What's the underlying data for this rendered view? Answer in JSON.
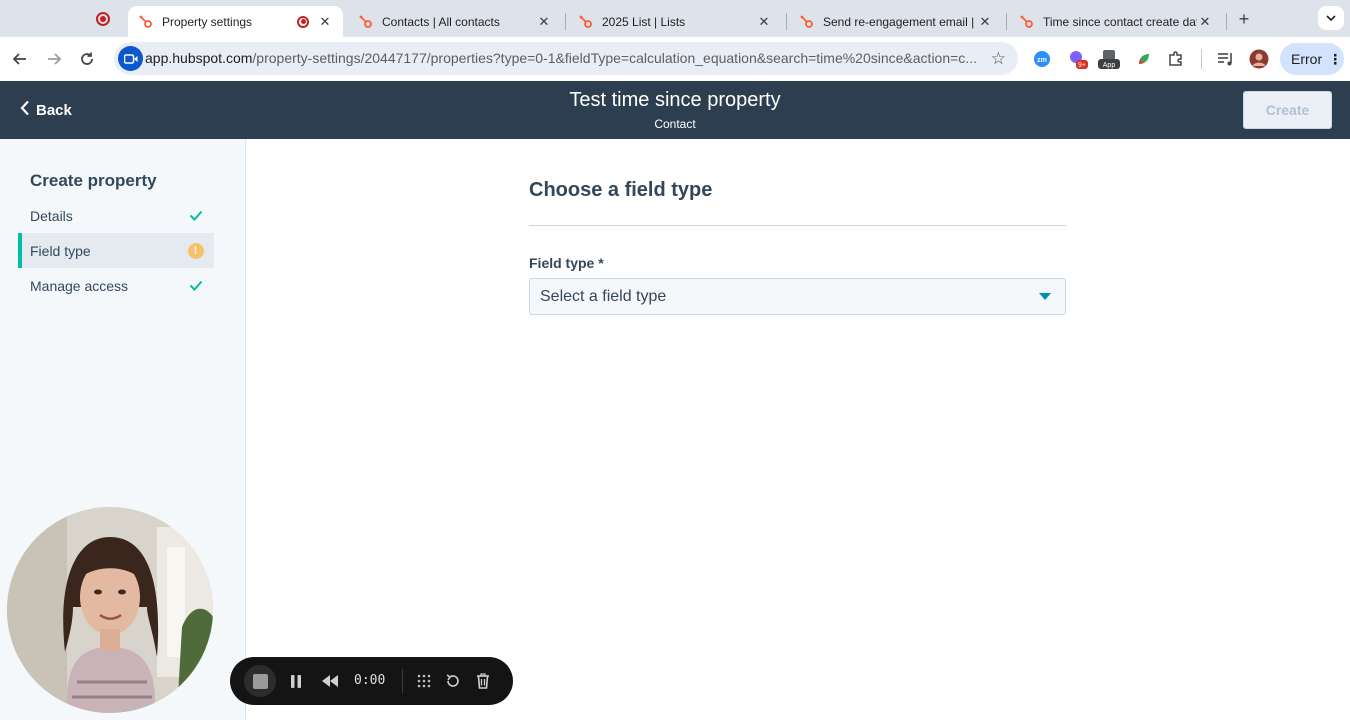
{
  "browser": {
    "tabs": [
      {
        "title": "Property settings",
        "active": true
      },
      {
        "title": "Contacts | All contacts",
        "active": false
      },
      {
        "title": "2025 List | Lists",
        "active": false
      },
      {
        "title": "Send re-engagement email | ",
        "active": false
      },
      {
        "title": "Time since contact create dat",
        "active": false
      }
    ],
    "url_host": "app.hubspot.com",
    "url_path": "/property-settings/20447177/properties?type=0-1&fieldType=calculation_equation&search=time%20since&action=c...",
    "extensions": {
      "zoom_label": "zm",
      "badge": "9+",
      "app_label": "App"
    },
    "profile_status": "Error"
  },
  "header": {
    "back_label": "Back",
    "title": "Test time since property",
    "subtitle": "Contact",
    "create_label": "Create"
  },
  "sidebar": {
    "title": "Create property",
    "steps": [
      {
        "label": "Details",
        "status": "complete"
      },
      {
        "label": "Field type",
        "status": "warning"
      },
      {
        "label": "Manage access",
        "status": "complete"
      }
    ]
  },
  "main": {
    "heading": "Choose a field type",
    "field_label": "Field type *",
    "select_placeholder": "Select a field type"
  },
  "recorder": {
    "timer": "0:00"
  },
  "colors": {
    "header_bg": "#2d3e50",
    "accent_teal": "#00bda5",
    "warning": "#f5c26b",
    "caret": "#0091ae"
  }
}
